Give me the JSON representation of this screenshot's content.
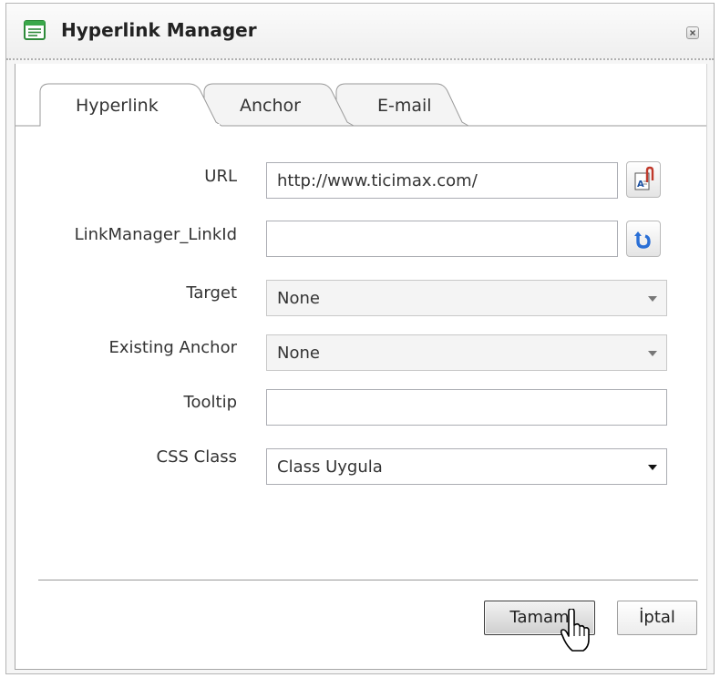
{
  "window": {
    "title": "Hyperlink Manager"
  },
  "tabs": [
    {
      "label": "Hyperlink",
      "active": true
    },
    {
      "label": "Anchor",
      "active": false
    },
    {
      "label": "E-mail",
      "active": false
    }
  ],
  "form": {
    "url": {
      "label": "URL",
      "value": "http://www.ticimax.com/"
    },
    "link_id": {
      "label": "LinkManager_LinkId",
      "value": ""
    },
    "target": {
      "label": "Target",
      "selected": "None"
    },
    "existing_anchor": {
      "label": "Existing Anchor",
      "selected": "None"
    },
    "tooltip": {
      "label": "Tooltip",
      "value": ""
    },
    "css_class": {
      "label": "CSS Class",
      "selected": "Class Uygula"
    }
  },
  "buttons": {
    "ok": "Tamam",
    "cancel": "İptal"
  },
  "colors": {
    "refresh_icon": "#2a6fd6",
    "paperclip": "#c0392b"
  }
}
